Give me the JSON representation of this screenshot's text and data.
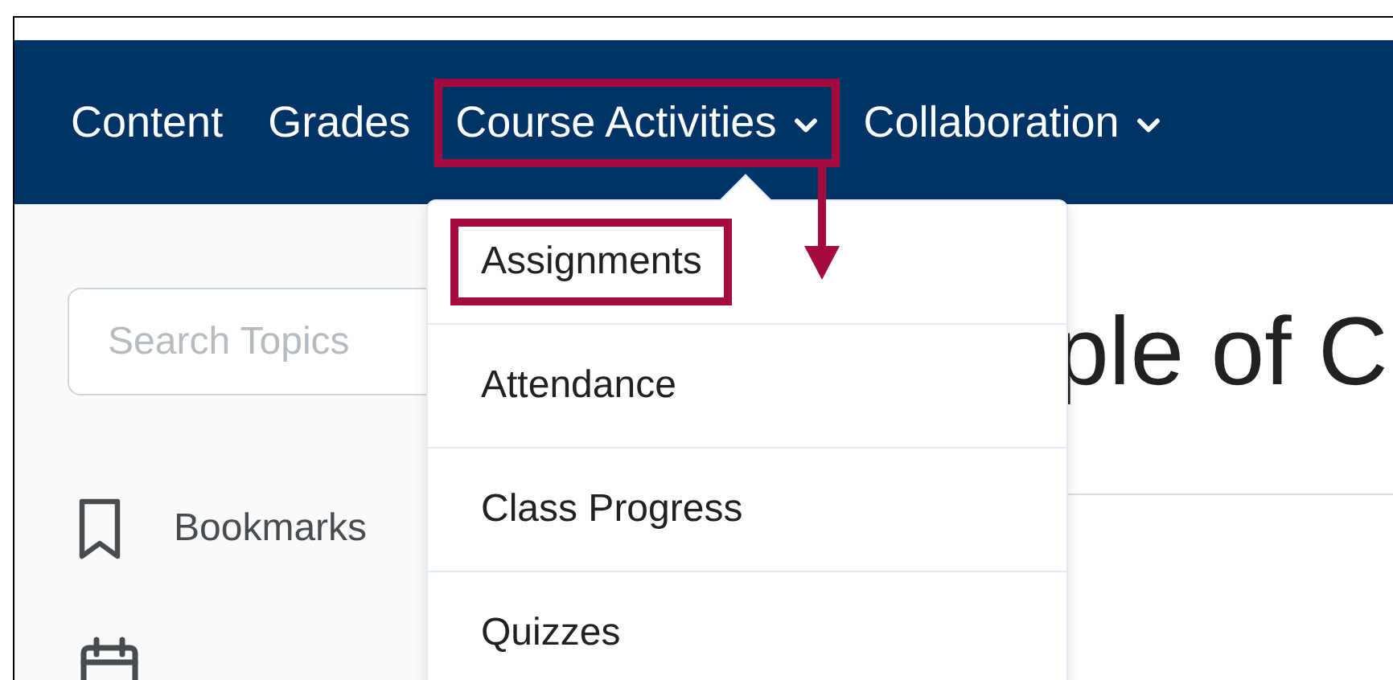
{
  "nav": {
    "items": [
      {
        "label": "Content",
        "has_menu": false,
        "highlighted": false
      },
      {
        "label": "Grades",
        "has_menu": false,
        "highlighted": false
      },
      {
        "label": "Course Activities",
        "has_menu": true,
        "highlighted": true
      },
      {
        "label": "Collaboration",
        "has_menu": true,
        "highlighted": false
      }
    ]
  },
  "dropdown": {
    "items": [
      {
        "label": "Assignments",
        "highlighted": true
      },
      {
        "label": "Attendance",
        "highlighted": false
      },
      {
        "label": "Class Progress",
        "highlighted": false
      },
      {
        "label": "Quizzes",
        "highlighted": false
      }
    ]
  },
  "sidebar": {
    "search": {
      "placeholder": "Search Topics"
    },
    "items": [
      {
        "kind": "bookmark",
        "label": "Bookmarks"
      },
      {
        "kind": "calendar"
      }
    ]
  },
  "main": {
    "heading": "ple of C"
  }
}
